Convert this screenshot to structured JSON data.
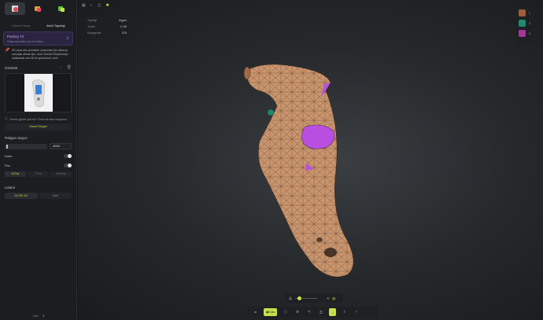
{
  "sidebar": {
    "tabs": [
      "Yüksek Detay",
      "Akıllı Topoloji"
    ],
    "model": {
      "name": "Parsley T2",
      "desc": "Geçiş ayrıntıları için en hızlısı"
    },
    "notice": "2D veya düz çizimlerin çıkarımlar için daha iyi sonuçlar almak için, önce Görseli Oluşturmayı kullanarak ona 3D bir görünümü verin.",
    "preview_title": "Görüntü",
    "suggest": "Henüz görsel yok mu? Önce bir tane oluşturun.",
    "suggest_btn": "Görsel Oluştur",
    "poly_title": "Poligon Sayısı",
    "poly_value": "4000",
    "texture_label": "Doku",
    "pos_label": "Poz",
    "pose_options": [
      "A-Poz",
      "T-Poz",
      "Serbest"
    ],
    "license_title": "Lisans",
    "license_options": [
      "CC BY 4.0",
      "Özel"
    ],
    "credits": [
      "2 on",
      "5"
    ]
  },
  "stats": [
    {
      "label": "Topoloji",
      "value": "Üçgen"
    },
    {
      "label": "Yüzler",
      "value": "1,118"
    },
    {
      "label": "Köşegenler",
      "value": "575"
    }
  ],
  "colors": [
    {
      "id": "1",
      "hex": "#a05d38"
    },
    {
      "id": "2",
      "hex": "#1c8b6e"
    },
    {
      "id": "3",
      "hex": "#a8359b"
    }
  ],
  "bottom": {
    "active_label": "Doku"
  },
  "accent": "#c4e34a",
  "model_color": "#c9956e",
  "model_accent": "#b94fe0"
}
